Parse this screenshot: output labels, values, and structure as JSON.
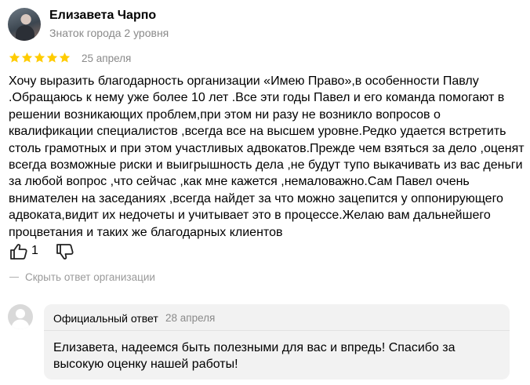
{
  "review": {
    "author": {
      "name": "Елизавета Чарпо",
      "level": "Знаток города 2 уровня",
      "avatar_icon": "user-photo"
    },
    "rating": 5,
    "rating_max": 5,
    "star_color": "#fc0",
    "date": "25 апреля",
    "text": "Хочу выразить благодарность организации «Имею Право»,в особенности Павлу .Обращаюсь к нему уже более 10 лет .Все эти годы Павел и его команда помогают в решении возникающих проблем,при этом ни разу не возникло вопросов о квалификации специалистов ,всегда все на высшем уровне.Редко удается встретить столь грамотных и при этом участливых адвокатов.Прежде чем взяться за дело ,оценят всегда возможные риски и выигрышность дела ,не будут тупо выкачивать из вас деньги за любой вопрос ,что сейчас ,как мне кажется ,немаловажно.Сам Павел очень внимателен на заседаниях ,всегда найдет за что можно зацепится у оппонирующего адвоката,видит их недочеты и учитывает это в процессе.Желаю вам дальнейшего процветания и таких же благодарных клиентов",
    "likes": "1",
    "like_icon": "thumb-up-icon",
    "dislike_icon": "thumb-down-icon"
  },
  "reply_toggle": {
    "label": "Скрыть ответ организации"
  },
  "reply": {
    "avatar_icon": "default-user-avatar",
    "title": "Официальный ответ",
    "date": "28 апреля",
    "text": "Елизавета, надеемся быть полезными для вас и впредь! Спасибо за высокую оценку нашей работы!",
    "background": "#f2f2f2"
  }
}
